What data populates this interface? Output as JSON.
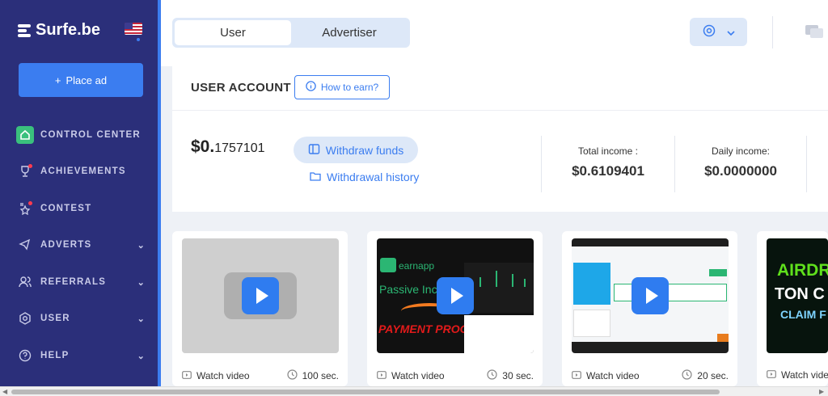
{
  "brand": {
    "name": "Surfe.be"
  },
  "sidebar": {
    "place_ad": "Place ad",
    "items": [
      {
        "label": "CONTROL CENTER",
        "icon": "home-icon"
      },
      {
        "label": "ACHIEVEMENTS",
        "icon": "trophy-icon"
      },
      {
        "label": "CONTEST",
        "icon": "star-podium-icon"
      },
      {
        "label": "ADVERTS",
        "icon": "megaphone-icon"
      },
      {
        "label": "REFERRALS",
        "icon": "users-icon"
      },
      {
        "label": "USER",
        "icon": "gear-icon"
      },
      {
        "label": "HELP",
        "icon": "question-icon"
      }
    ]
  },
  "header": {
    "tabs": [
      "User",
      "Advertiser"
    ],
    "active_tab": "User"
  },
  "account": {
    "title": "USER ACCOUNT",
    "how_to_earn": "How to earn?",
    "balance_main": "$0.",
    "balance_fraction": "1757101",
    "withdraw_funds": "Withdraw funds",
    "withdrawal_history": "Withdrawal history",
    "total_income_label": "Total income :",
    "total_income_value": "$0.6109401",
    "daily_income_label": "Daily income:",
    "daily_income_value": "$0.0000000"
  },
  "videos": [
    {
      "label": "Watch video",
      "duration": "100 sec."
    },
    {
      "label": "Watch video",
      "duration": "30 sec."
    },
    {
      "label": "Watch video",
      "duration": "20 sec."
    },
    {
      "label": "Watch video",
      "duration": ""
    }
  ],
  "thumb_text": {
    "earnapp": "earnapp",
    "passive": "Passive Inc",
    "payment": "PAYMENT PROOF",
    "airdrop": "AIRDR",
    "ton": "TON C",
    "claim": "CLAIM F"
  },
  "colors": {
    "sidebar": "#2b2f7a",
    "accent": "#3b7df0",
    "active_green": "#3ac07d"
  }
}
